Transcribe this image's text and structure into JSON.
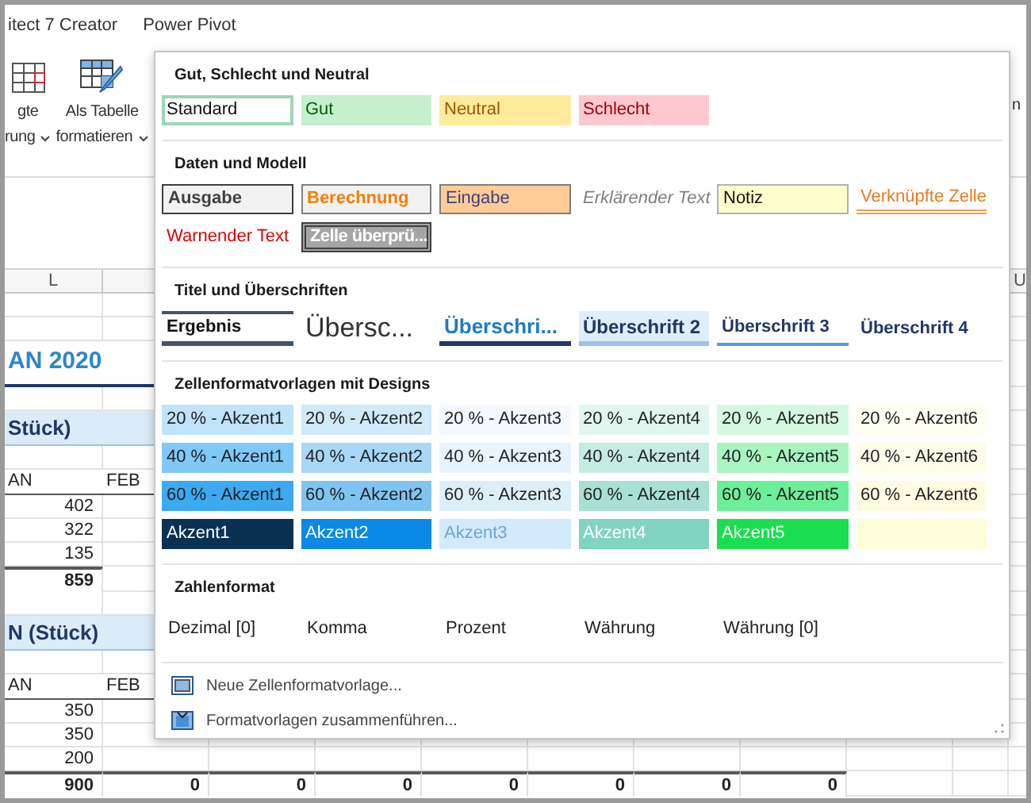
{
  "ribbon_tabs": [
    "itect 7 Creator",
    "Power Pivot"
  ],
  "ribbon_buttons": [
    {
      "kind": "grid",
      "lines": [
        "gte",
        "rung"
      ],
      "dropdown": true
    },
    {
      "kind": "table-brush",
      "lines": [
        "Als Tabelle",
        "formatieren"
      ],
      "dropdown": true
    }
  ],
  "ribbon_right_text": "n",
  "sheet": {
    "column_headers": [
      "L",
      "U"
    ],
    "rows": [
      {
        "kind": "empty",
        "cells": []
      },
      {
        "kind": "empty",
        "cells": []
      },
      {
        "kind": "title",
        "cells": [
          "AN 2020"
        ]
      },
      {
        "kind": "empty",
        "cells": []
      },
      {
        "kind": "band",
        "cells": [
          "Stück)"
        ]
      },
      {
        "kind": "empty",
        "cells": []
      },
      {
        "kind": "header",
        "cells": [
          "AN",
          "FEB"
        ]
      },
      {
        "kind": "value",
        "cells": [
          "402"
        ]
      },
      {
        "kind": "value",
        "cells": [
          "322"
        ]
      },
      {
        "kind": "value",
        "cells": [
          "135"
        ]
      },
      {
        "kind": "total",
        "cells": [
          "859"
        ]
      },
      {
        "kind": "empty",
        "cells": []
      },
      {
        "kind": "band",
        "cells": [
          "N (Stück)"
        ]
      },
      {
        "kind": "empty",
        "cells": []
      },
      {
        "kind": "header",
        "cells": [
          "AN",
          "FEB"
        ]
      },
      {
        "kind": "value",
        "cells": [
          "350"
        ]
      },
      {
        "kind": "value",
        "cells": [
          "350"
        ]
      },
      {
        "kind": "value",
        "cells": [
          "200"
        ]
      },
      {
        "kind": "total",
        "cells": [
          "900",
          "0",
          "0",
          "0",
          "0",
          "0",
          "0",
          "0"
        ]
      }
    ]
  },
  "style_gallery": {
    "sections": [
      {
        "title": "Gut, Schlecht und Neutral",
        "kind": "styles",
        "items": [
          {
            "label": "Standard",
            "kind": "standard",
            "selected": true
          },
          {
            "label": "Gut",
            "kind": "good",
            "selected": false
          },
          {
            "label": "Neutral",
            "kind": "neutral",
            "selected": false
          },
          {
            "label": "Schlecht",
            "kind": "bad",
            "selected": false
          }
        ]
      },
      {
        "title": "Daten und Modell",
        "kind": "styles",
        "items": [
          {
            "label": "Ausgabe",
            "kind": "output",
            "selected": false
          },
          {
            "label": "Berechnung",
            "kind": "calculation",
            "selected": false
          },
          {
            "label": "Eingabe",
            "kind": "input",
            "selected": false
          },
          {
            "label": "Erklärender Text",
            "kind": "explanatory",
            "selected": false
          },
          {
            "label": "Notiz",
            "kind": "note",
            "selected": false
          },
          {
            "label": "Verknüpfte Zelle",
            "kind": "linked",
            "selected": false
          },
          {
            "label": "Warnender Text",
            "kind": "warning",
            "selected": false
          },
          {
            "label": "Zelle überprü...",
            "kind": "check",
            "selected": false
          }
        ]
      },
      {
        "title": "Titel und Überschriften",
        "kind": "titles",
        "items": [
          {
            "label": "Ergebnis",
            "kind": "total",
            "selected": false
          },
          {
            "label": "Übersc...",
            "kind": "title",
            "selected": false
          },
          {
            "label": "Überschri...",
            "kind": "h1",
            "selected": false
          },
          {
            "label": "Überschrift 2",
            "kind": "h2",
            "selected": false
          },
          {
            "label": "Überschrift 3",
            "kind": "h3",
            "selected": false
          },
          {
            "label": "Überschrift 4",
            "kind": "h4",
            "selected": false
          }
        ]
      },
      {
        "title": "Zellenformatvorlagen mit Designs",
        "kind": "styles",
        "items": [
          {
            "label": "20 % - Akzent1",
            "kind": "tint",
            "color": "#bfe3fa",
            "selected": false
          },
          {
            "label": "20 % - Akzent2",
            "kind": "tint",
            "color": "#d0e9fb",
            "selected": false
          },
          {
            "label": "20 % - Akzent3",
            "kind": "tint",
            "color": "#f3f9fe",
            "selected": false
          },
          {
            "label": "20 % - Akzent4",
            "kind": "tint",
            "color": "#e2f6f0",
            "selected": false
          },
          {
            "label": "20 % - Akzent5",
            "kind": "tint",
            "color": "#d3f9e1",
            "selected": false
          },
          {
            "label": "20 % - Akzent6",
            "kind": "tint",
            "color": "#fffef3",
            "selected": false
          },
          {
            "label": "40 % - Akzent1",
            "kind": "tint",
            "color": "#80c9f7",
            "selected": false
          },
          {
            "label": "40 % - Akzent2",
            "kind": "tint",
            "color": "#a9d7f7",
            "selected": false
          },
          {
            "label": "40 % - Akzent3",
            "kind": "tint",
            "color": "#e8f4fd",
            "selected": false
          },
          {
            "label": "40 % - Akzent4",
            "kind": "tint",
            "color": "#c5ece2",
            "selected": false
          },
          {
            "label": "40 % - Akzent5",
            "kind": "tint",
            "color": "#a8f5c2",
            "selected": false
          },
          {
            "label": "40 % - Akzent6",
            "kind": "tint",
            "color": "#fffdea",
            "selected": false
          },
          {
            "label": "60 % - Akzent1",
            "kind": "tint",
            "color": "#3ca9f1",
            "selected": false
          },
          {
            "label": "60 % - Akzent2",
            "kind": "tint",
            "color": "#80c4f2",
            "selected": false
          },
          {
            "label": "60 % - Akzent3",
            "kind": "tint",
            "color": "#dcf0fc",
            "selected": false
          },
          {
            "label": "60 % - Akzent4",
            "kind": "tint",
            "color": "#a8e1d3",
            "selected": false
          },
          {
            "label": "60 % - Akzent5",
            "kind": "tint",
            "color": "#6def99",
            "selected": false
          },
          {
            "label": "60 % - Akzent6",
            "kind": "tint",
            "color": "#fffce2",
            "selected": false
          },
          {
            "label": "Akzent1",
            "kind": "solid",
            "color": "#0b3152",
            "selected": false
          },
          {
            "label": "Akzent2",
            "kind": "solid",
            "color": "#0a8ae6",
            "selected": false
          },
          {
            "label": "Akzent3",
            "kind": "pale",
            "color": "#d2eafb",
            "selected": false
          },
          {
            "label": "Akzent4",
            "kind": "solid",
            "color": "#80d4c1",
            "selected": false
          },
          {
            "label": "Akzent5",
            "kind": "solid",
            "color": "#1add4f",
            "selected": false
          },
          {
            "kind": "solid",
            "color": "#fffcda",
            "selected": false
          }
        ]
      },
      {
        "title": "Zahlenformat",
        "kind": "formats",
        "items": [
          {
            "label": "Dezimal [0]",
            "selected": false
          },
          {
            "label": "Komma",
            "selected": false
          },
          {
            "label": "Prozent",
            "selected": false
          },
          {
            "label": "Währung",
            "selected": false
          },
          {
            "label": "Währung [0]",
            "selected": false
          }
        ]
      }
    ],
    "menu": [
      {
        "label": "Neue Zellenformatvorlage...",
        "kind": "new"
      },
      {
        "label": "Formatvorlagen zusammenführen...",
        "kind": "merge"
      }
    ]
  }
}
